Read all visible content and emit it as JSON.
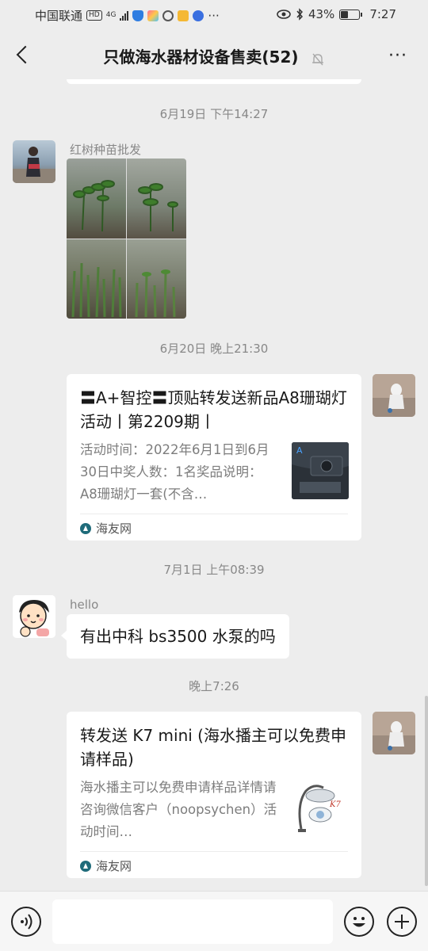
{
  "status_bar": {
    "carrier": "中国联通",
    "network_badge": "HD",
    "signal_type": "4G",
    "battery_percent": "43%",
    "battery_level": 0.43,
    "time": "7:27",
    "overflow_dots": "···",
    "icons": [
      "signal-bars-icon",
      "shield-icon",
      "app-icon",
      "circle-icon",
      "note-icon",
      "music-icon",
      "eye-icon",
      "bluetooth-icon",
      "battery-icon"
    ]
  },
  "header": {
    "title": "只做海水器材设备售卖(52)",
    "more_label": "···",
    "icons": [
      "back-icon",
      "mute-bell-icon",
      "more-icon"
    ]
  },
  "messages": [
    {
      "type": "timestamp",
      "text": "6月19日 下午14:27"
    },
    {
      "type": "image_grid",
      "sender": "红树种苗批发",
      "images": [
        "mangrove-seedlings-photo-1",
        "mangrove-seedlings-photo-2",
        "mangrove-seedlings-photo-3",
        "mangrove-seedlings-photo-4"
      ]
    },
    {
      "type": "timestamp",
      "text": "6月20日 晚上21:30"
    },
    {
      "type": "link_card",
      "outgoing": true,
      "title": "〓A+智控〓顶贴转发送新品A8珊瑚灯活动丨第2209期丨",
      "description": "活动时间：2022年6月1日到6月30日中奖人数：1名奖品说明：A8珊瑚灯一套(不含…",
      "source": "海友网",
      "thumbnail": "a8-coral-lamp-thumbnail"
    },
    {
      "type": "timestamp",
      "text": "7月1日 上午08:39"
    },
    {
      "type": "text",
      "sender": "hello",
      "text": "有出中科 bs3500 水泵的吗"
    },
    {
      "type": "timestamp",
      "text": "晚上7:26"
    },
    {
      "type": "link_card",
      "outgoing": true,
      "title": "转发送 K7 mini (海水播主可以免费申请样品)",
      "description": "海水播主可以免费申请样品详情请咨询微信客户（noopsychen）活动时间…",
      "source": "海友网",
      "thumbnail": "k7-mini-lamp-thumbnail"
    }
  ],
  "input_bar": {
    "placeholder": "",
    "icons": [
      "voice-icon",
      "emoji-icon",
      "plus-icon"
    ]
  },
  "colors": {
    "background": "#ededed",
    "bubble": "#ffffff",
    "timestamp_text": "#888888",
    "input_bar": "#f6f6f6"
  }
}
